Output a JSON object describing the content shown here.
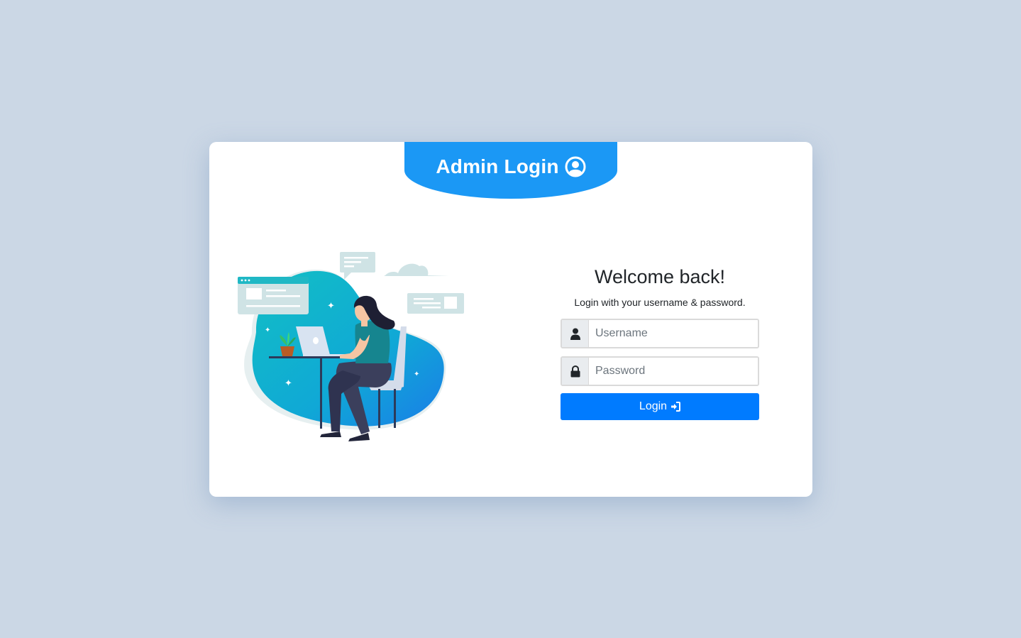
{
  "header": {
    "title": "Admin Login",
    "icon": "user-circle-icon",
    "color": "#1b98f5"
  },
  "form": {
    "welcome": "Welcome back!",
    "subtitle": "Login with your username & password.",
    "username_placeholder": "Username",
    "username_icon": "user-icon",
    "password_placeholder": "Password",
    "password_icon": "lock-icon",
    "login_label": "Login",
    "login_icon": "sign-in-icon",
    "accent": "#007bff"
  },
  "illustration": {
    "name": "woman-working-on-laptop-illustration"
  },
  "colors": {
    "background": "#cbd7e5",
    "card": "#ffffff"
  }
}
